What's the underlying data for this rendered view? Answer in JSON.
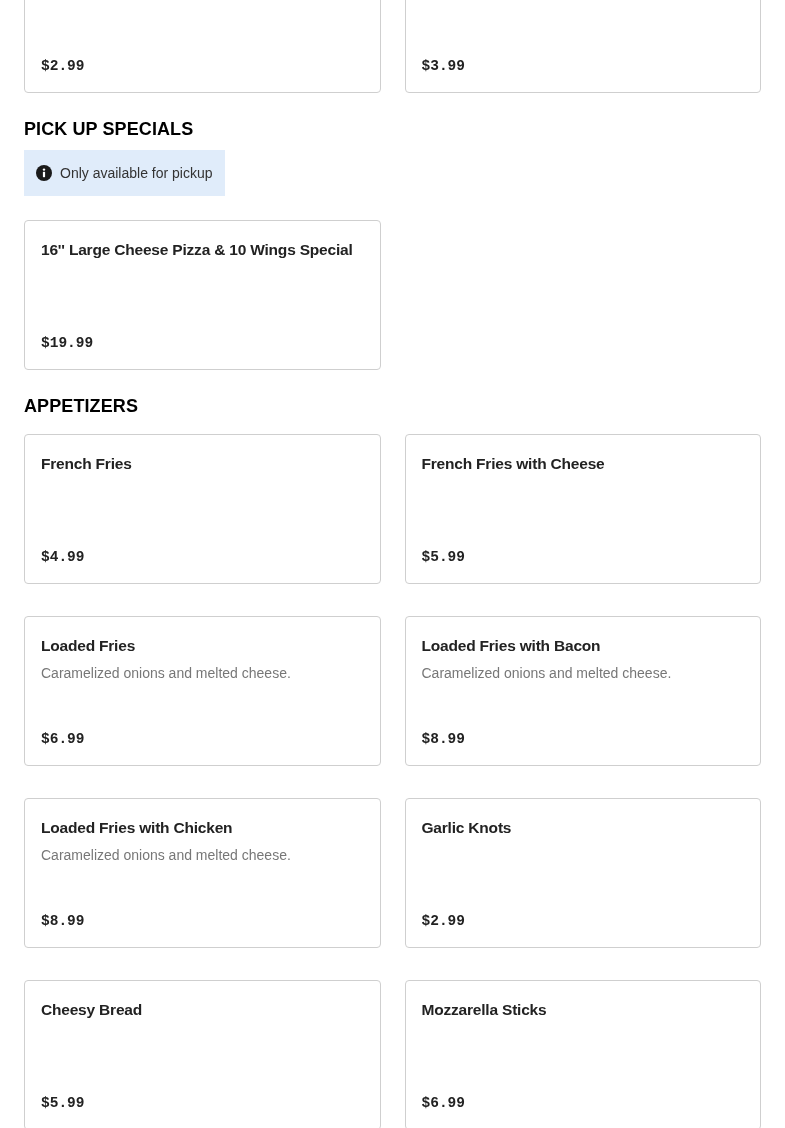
{
  "previous_section": {
    "items": [
      {
        "price": "$2.99"
      },
      {
        "price": "$3.99"
      }
    ]
  },
  "sections": [
    {
      "heading": "PICK UP SPECIALS",
      "notice": "Only available for pickup",
      "items": [
        {
          "name": "16'' Large Cheese Pizza & 10 Wings Special",
          "price": "$19.99"
        }
      ]
    },
    {
      "heading": "APPETIZERS",
      "items": [
        {
          "name": "French Fries",
          "price": "$4.99"
        },
        {
          "name": "French Fries with Cheese",
          "price": "$5.99"
        },
        {
          "name": "Loaded Fries",
          "description": "Caramelized onions and melted cheese.",
          "price": "$6.99"
        },
        {
          "name": "Loaded Fries with Bacon",
          "description": "Caramelized onions and melted cheese.",
          "price": "$8.99"
        },
        {
          "name": "Loaded Fries with Chicken",
          "description": "Caramelized onions and melted cheese.",
          "price": "$8.99"
        },
        {
          "name": "Garlic Knots",
          "price": "$2.99"
        },
        {
          "name": "Cheesy Bread",
          "price": "$5.99"
        },
        {
          "name": "Mozzarella Sticks",
          "price": "$6.99"
        }
      ]
    }
  ]
}
